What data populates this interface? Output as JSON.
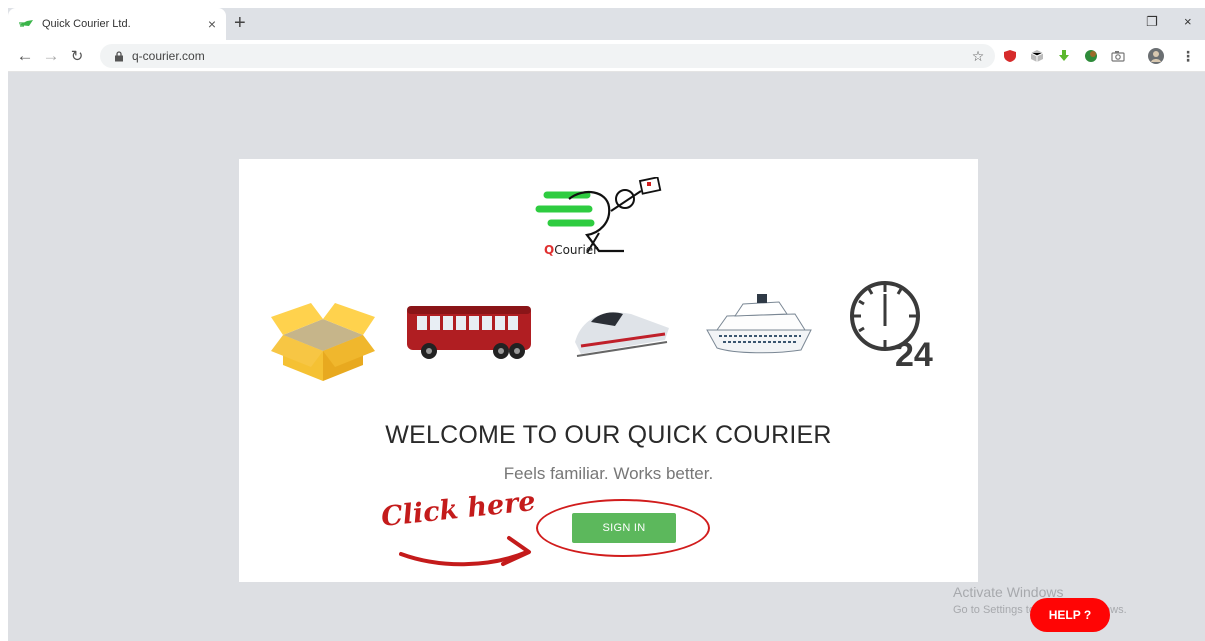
{
  "browser": {
    "tab_title": "Quick Courier Ltd.",
    "tab_close": "×",
    "new_tab": "+",
    "url": "q-courier.com",
    "win_restore": "❐",
    "win_close": "×"
  },
  "page": {
    "logo_q": "Q",
    "logo_rest": "Courier",
    "heading": "WELCOME TO OUR QUICK COURIER",
    "tagline": "Feels familiar. Works better.",
    "signin_label": "SIGN IN",
    "annotation": "Click here",
    "clock_number": "24",
    "help_label": "HELP ?"
  },
  "watermark": {
    "line1": "Activate Windows",
    "line2": "Go to Settings to activate Windows."
  },
  "colors": {
    "accent_green": "#5cb85c",
    "annotation_red": "#d11c1c",
    "help_red": "#ff0505",
    "page_bg": "#dddfe3"
  },
  "icons": [
    "box-icon",
    "bus-icon",
    "train-icon",
    "ship-icon",
    "clock-24-icon"
  ]
}
